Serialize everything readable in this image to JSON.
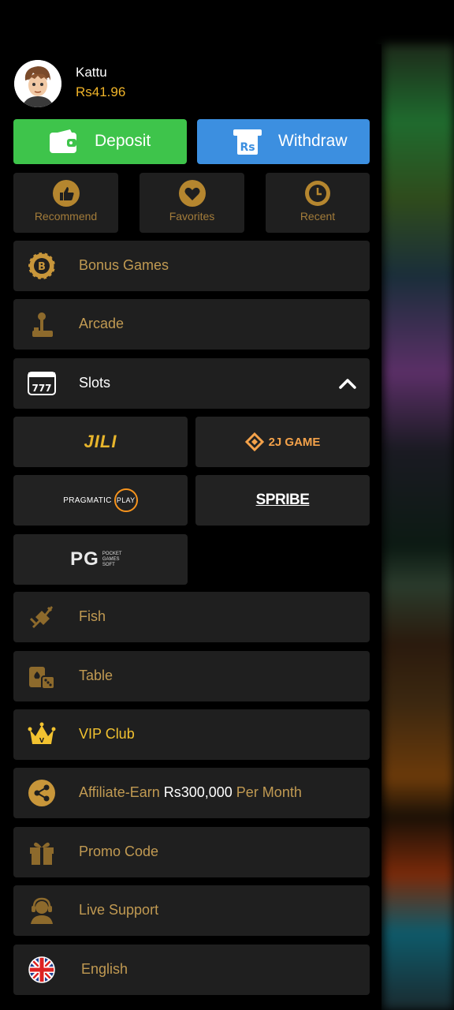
{
  "user": {
    "name": "Kattu",
    "balance": "Rs41.96"
  },
  "actions": {
    "deposit": "Deposit",
    "withdraw": "Withdraw"
  },
  "quick": [
    {
      "label": "Recommend",
      "icon": "thumbs-up-icon"
    },
    {
      "label": "Favorites",
      "icon": "heart-icon"
    },
    {
      "label": "Recent",
      "icon": "clock-icon"
    }
  ],
  "menu": {
    "bonus": "Bonus Games",
    "arcade": "Arcade",
    "slots": "Slots",
    "fish": "Fish",
    "table": "Table",
    "vip": "VIP Club",
    "affiliate_prefix": "Affiliate-Earn ",
    "affiliate_amount": "Rs300,000",
    "affiliate_suffix": " Per Month",
    "promo": "Promo Code",
    "support": "Live Support",
    "language": "English"
  },
  "providers": {
    "jili": "JILI",
    "twoj": "2J GAME",
    "pragmatic": "PRAGMATIC",
    "pragmatic_play": "PLAY",
    "spribe": "SPRIBE",
    "pg": "PG",
    "pg_small": "POCKET GAMES SOFT"
  },
  "colors": {
    "gold": "#c19a52",
    "deposit": "#3ec44b",
    "withdraw": "#3c8fe0",
    "panel": "#1f1f1f"
  }
}
